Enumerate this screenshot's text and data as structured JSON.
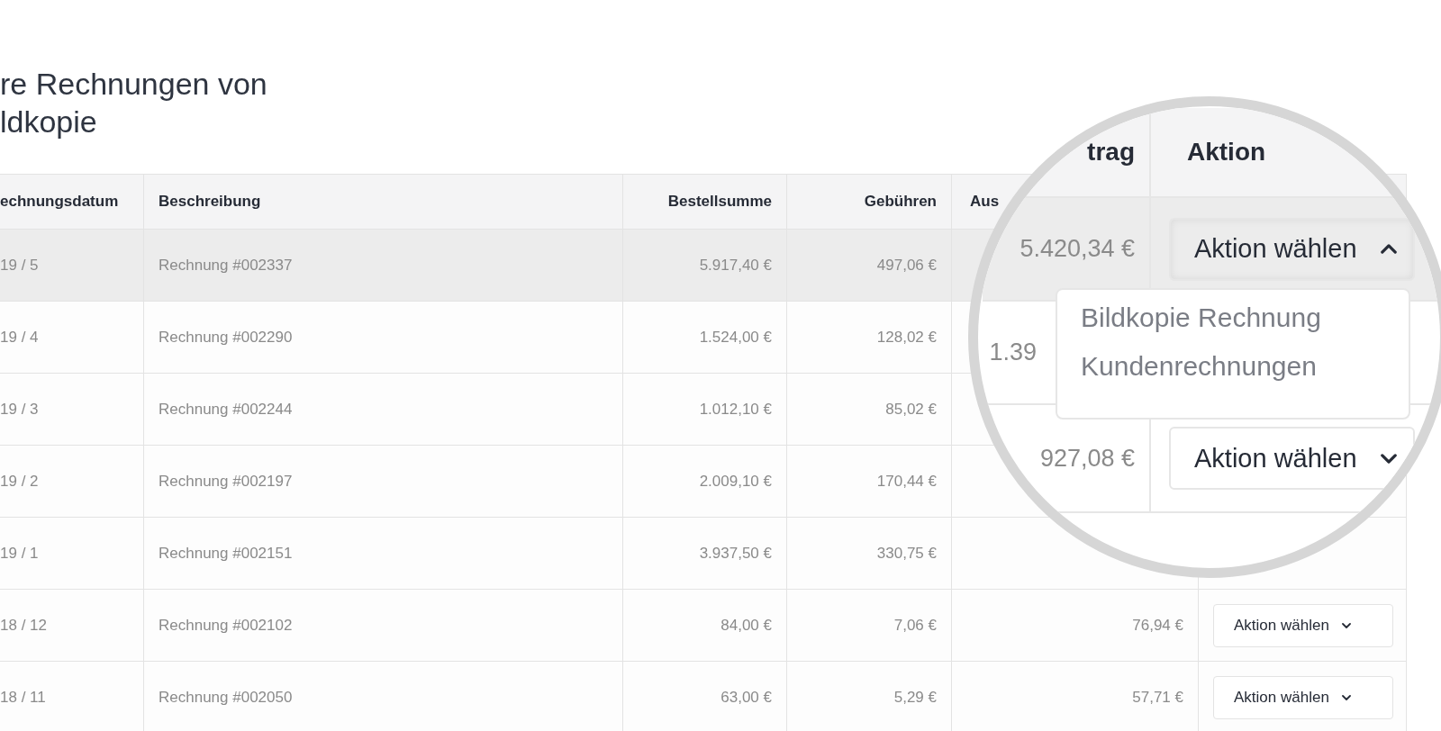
{
  "title_lines": [
    "re Rechnungen von",
    "ldkopie"
  ],
  "table": {
    "columns": [
      "echnungsdatum",
      "Beschreibung",
      "Bestellsumme",
      "Gebühren",
      "Aus"
    ],
    "rows": [
      {
        "date": "19 / 5",
        "description": "Rechnung #002337",
        "order_total": "5.917,40 €",
        "fees": "497,06 €",
        "highlighted": true
      },
      {
        "date": "19 / 4",
        "description": "Rechnung #002290",
        "order_total": "1.524,00 €",
        "fees": "128,02 €",
        "highlighted": false
      },
      {
        "date": "19 / 3",
        "description": "Rechnung #002244",
        "order_total": "1.012,10 €",
        "fees": "85,02 €",
        "highlighted": false
      },
      {
        "date": "19 / 2",
        "description": "Rechnung #002197",
        "order_total": "2.009,10 €",
        "fees": "170,44 €",
        "highlighted": false
      },
      {
        "date": "19 / 1",
        "description": "Rechnung #002151",
        "order_total": "3.937,50 €",
        "fees": "330,75 €",
        "highlighted": false
      },
      {
        "date": "18 / 12",
        "description": "Rechnung #002102",
        "order_total": "84,00 €",
        "fees": "7,06 €",
        "payout": "76,94 €",
        "action": "Aktion wählen",
        "open": false,
        "highlighted": false
      },
      {
        "date": "18 / 11",
        "description": "Rechnung #002050",
        "order_total": "63,00 €",
        "fees": "5,29 €",
        "payout": "57,71 €",
        "action": "Aktion wählen",
        "open": false,
        "highlighted": false
      }
    ]
  },
  "magnifier": {
    "columns": [
      "trag",
      "Aktion"
    ],
    "rows": [
      {
        "payout": "5.420,34 €",
        "action": "Aktion wählen",
        "open": true,
        "highlighted": true,
        "menu": [
          "Bildkopie Rechnung",
          "Kundenrechnungen"
        ]
      },
      {
        "payout": "1.39",
        "highlighted": false
      },
      {
        "payout": "927,08 €",
        "action": "Aktion wählen",
        "open": false,
        "highlighted": false
      }
    ]
  }
}
